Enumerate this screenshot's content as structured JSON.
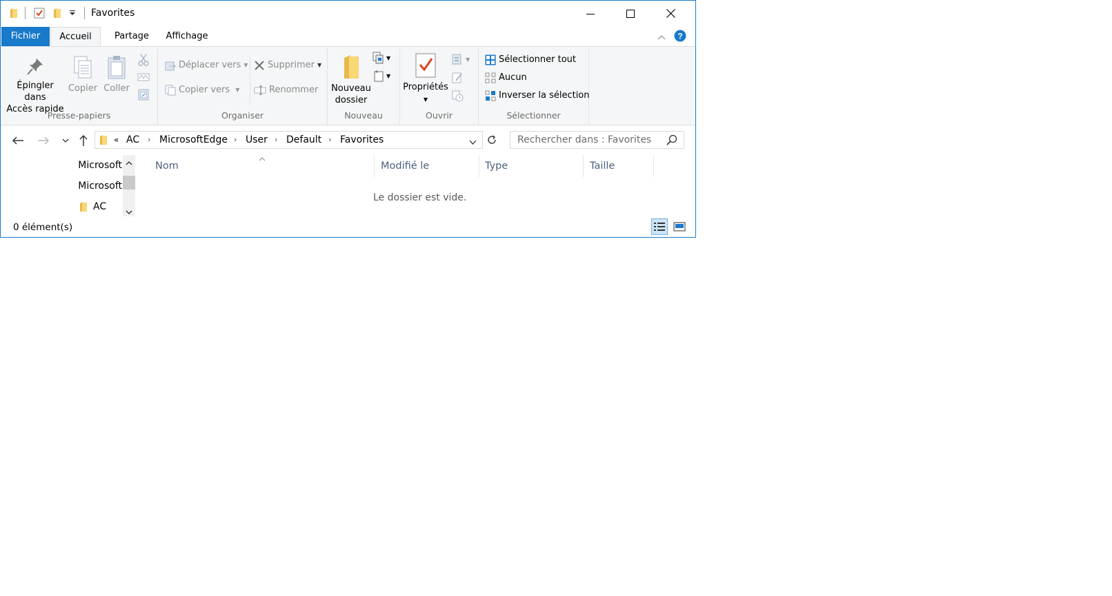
{
  "window": {
    "title": "Favorites"
  },
  "icons": {
    "folder": "folder-icon",
    "properties": "properties-checkbox-icon",
    "dropdown": "chevron-down-icon",
    "minimize": "minimize-icon",
    "maximize": "maximize-icon",
    "close": "close-icon",
    "help": "help-icon"
  },
  "tabs": [
    {
      "label": "Fichier"
    },
    {
      "label": "Accueil"
    },
    {
      "label": "Partage"
    },
    {
      "label": "Affichage"
    }
  ],
  "ribbon": {
    "clipboard": {
      "pin_line1": "Épingler dans",
      "pin_line2": "Accès rapide",
      "copy": "Copier",
      "paste": "Coller",
      "label": "Presse-papiers"
    },
    "organize": {
      "move_to": "Déplacer vers",
      "copy_to": "Copier vers",
      "delete": "Supprimer",
      "rename": "Renommer",
      "label": "Organiser"
    },
    "new": {
      "new_folder_line1": "Nouveau",
      "new_folder_line2": "dossier",
      "label": "Nouveau"
    },
    "open": {
      "properties": "Propriétés",
      "label": "Ouvrir"
    },
    "select": {
      "select_all": "Sélectionner tout",
      "select_none": "Aucun",
      "invert": "Inverser la sélection",
      "label": "Sélectionner"
    }
  },
  "address": {
    "overflow": "«",
    "crumbs": [
      "AC",
      "MicrosoftEdge",
      "User",
      "Default",
      "Favorites"
    ]
  },
  "search": {
    "placeholder": "Rechercher dans : Favorites"
  },
  "nav_tree": [
    {
      "label": "Microsoft"
    },
    {
      "label": "Microsoft"
    },
    {
      "label": "AC"
    }
  ],
  "columns": [
    "Nom",
    "Modifié le",
    "Type",
    "Taille"
  ],
  "empty_message": "Le dossier est vide.",
  "status": {
    "count": "0 élément(s)"
  },
  "colors": {
    "accent": "#1979ca",
    "ribbon_bg": "#f5f6f7",
    "folder": "#f8d775",
    "header_text": "#4c607a"
  }
}
